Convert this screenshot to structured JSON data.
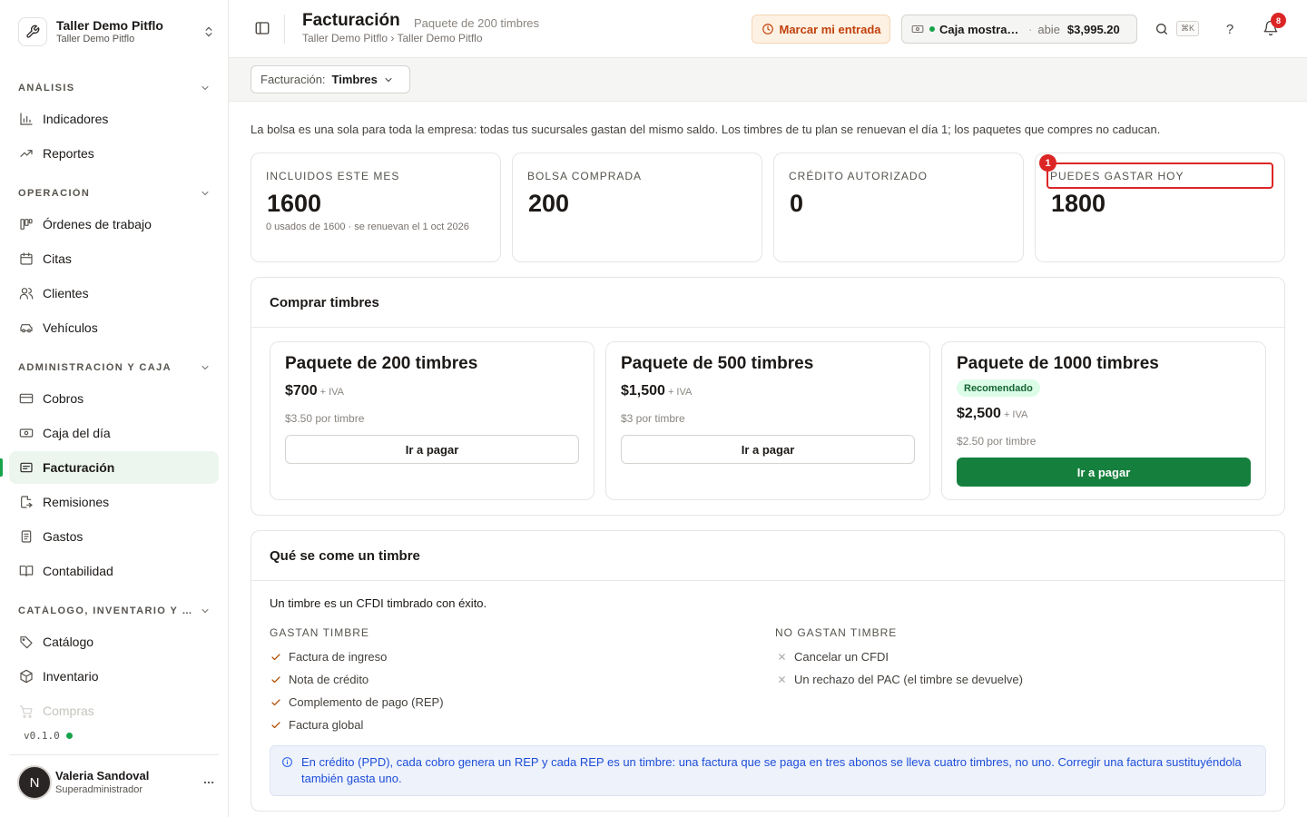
{
  "brand": {
    "name": "Taller Demo Pitflo",
    "subtitle": "Taller Demo Pitflo"
  },
  "sidebar": {
    "sections": [
      {
        "label": "Análisis",
        "items": [
          {
            "label": "Indicadores",
            "icon": "bar-chart-icon"
          },
          {
            "label": "Reportes",
            "icon": "trend-icon"
          }
        ]
      },
      {
        "label": "Operación",
        "items": [
          {
            "label": "Órdenes de trabajo",
            "icon": "kanban-icon"
          },
          {
            "label": "Citas",
            "icon": "calendar-icon"
          },
          {
            "label": "Clientes",
            "icon": "users-icon"
          },
          {
            "label": "Vehículos",
            "icon": "car-icon"
          }
        ]
      },
      {
        "label": "Administración y caja",
        "items": [
          {
            "label": "Cobros",
            "icon": "credit-card-icon"
          },
          {
            "label": "Caja del día",
            "icon": "banknote-icon"
          },
          {
            "label": "Facturación",
            "icon": "receipt-icon",
            "active": true
          },
          {
            "label": "Remisiones",
            "icon": "file-export-icon"
          },
          {
            "label": "Gastos",
            "icon": "document-icon"
          },
          {
            "label": "Contabilidad",
            "icon": "book-icon"
          }
        ]
      },
      {
        "label": "Catálogo, inventario y co...",
        "items": [
          {
            "label": "Catálogo",
            "icon": "tag-icon"
          },
          {
            "label": "Inventario",
            "icon": "box-icon"
          },
          {
            "label": "Compras",
            "icon": "cart-icon"
          }
        ]
      }
    ],
    "version": "v0.1.0"
  },
  "user": {
    "initial": "N",
    "name": "Valeria Sandoval",
    "role": "Superadministrador"
  },
  "topbar": {
    "title": "Facturación",
    "subtitle": "Paquete de 200 timbres",
    "breadcrumb": "Taller Demo Pitflo › Taller Demo Pitflo",
    "entry_button": "Marcar mi entrada",
    "caja": {
      "name": "Caja mostrad...",
      "separator": "·",
      "status": "abie",
      "amount": "$3,995.20"
    },
    "search_shortcut": "⌘K",
    "help_label": "?",
    "notifications": "8"
  },
  "filter": {
    "label": "Facturación:",
    "value": "Timbres"
  },
  "intro": "La bolsa es una sola para toda la empresa: todas tus sucursales gastan del mismo saldo. Los timbres de tu plan se renuevan el día 1; los paquetes que compres no caducan.",
  "stats": [
    {
      "label": "Incluidos este mes",
      "value": "1600",
      "note": "0 usados de 1600 · se renuevan el 1 oct 2026"
    },
    {
      "label": "Bolsa comprada",
      "value": "200",
      "note": ""
    },
    {
      "label": "Crédito autorizado",
      "value": "0",
      "note": ""
    },
    {
      "label": "Puedes gastar hoy",
      "value": "1800",
      "note": ""
    }
  ],
  "highlight_badge": "1",
  "buy": {
    "title": "Comprar timbres",
    "packages": [
      {
        "name": "Paquete de 200 timbres",
        "price": "$700",
        "tax": "+ IVA",
        "per": "$3.50 por timbre",
        "button": "Ir a pagar",
        "tag": ""
      },
      {
        "name": "Paquete de 500 timbres",
        "price": "$1,500",
        "tax": "+ IVA",
        "per": "$3 por timbre",
        "button": "Ir a pagar",
        "tag": ""
      },
      {
        "name": "Paquete de 1000 timbres",
        "price": "$2,500",
        "tax": "+ IVA",
        "per": "$2.50 por timbre",
        "button": "Ir a pagar",
        "tag": "Recomendado"
      }
    ]
  },
  "explain": {
    "title": "Qué se come un timbre",
    "lead": "Un timbre es un CFDI timbrado con éxito.",
    "spend_title": "Gastan timbre",
    "spend": [
      "Factura de ingreso",
      "Nota de crédito",
      "Complemento de pago (REP)",
      "Factura global"
    ],
    "nospend_title": "No gastan timbre",
    "nospend": [
      "Cancelar un CFDI",
      "Un rechazo del PAC (el timbre se devuelve)"
    ],
    "info": "En crédito (PPD), cada cobro genera un REP y cada REP es un timbre: una factura que se paga en tres abonos se lleva cuatro timbres, no uno. Corregir una factura sustituyéndola también gasta uno."
  }
}
